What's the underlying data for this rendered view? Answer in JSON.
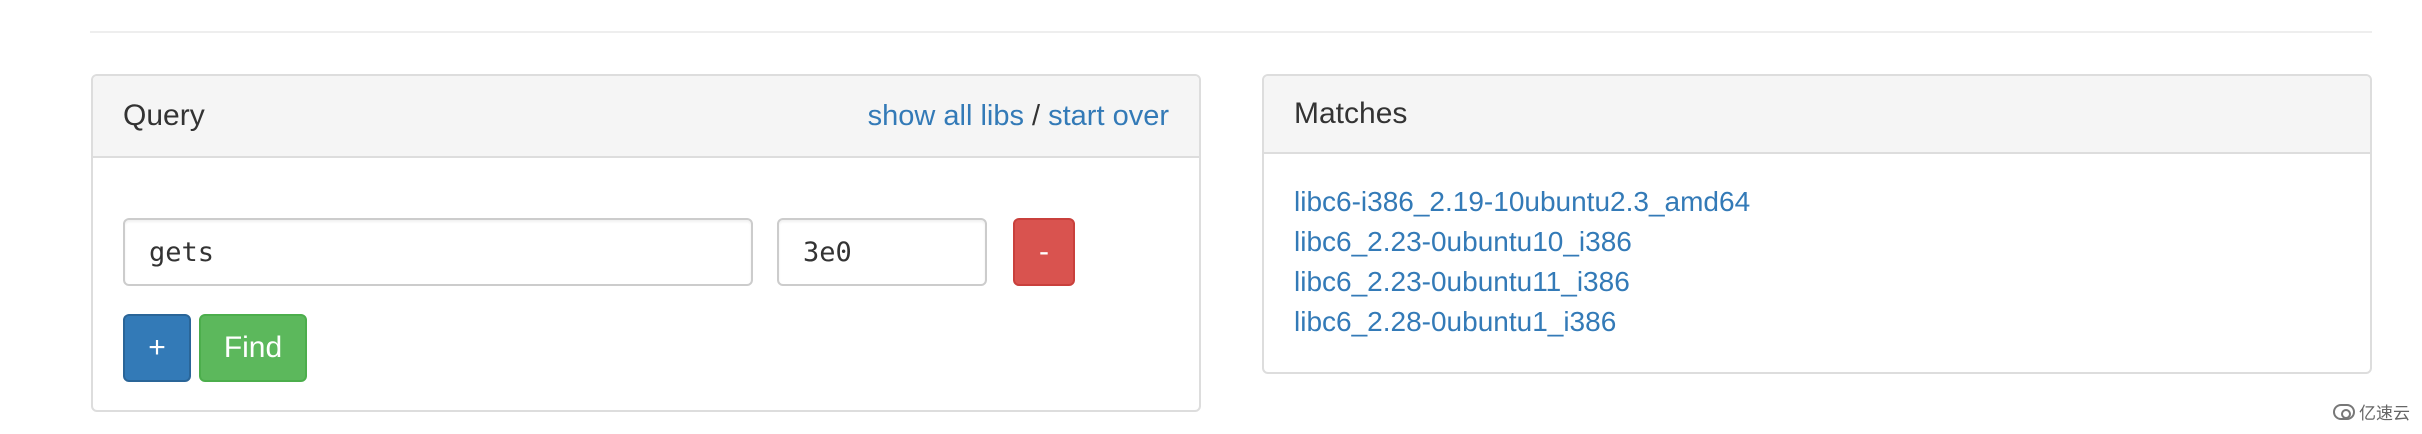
{
  "query": {
    "title": "Query",
    "show_all_label": "show all libs",
    "separator": " / ",
    "start_over_label": "start over",
    "symbol_value": "gets",
    "address_value": "3e0",
    "remove_label": "-",
    "add_label": "+",
    "find_label": "Find"
  },
  "matches": {
    "title": "Matches",
    "items": [
      "libc6-i386_2.19-10ubuntu2.3_amd64",
      "libc6_2.23-0ubuntu10_i386",
      "libc6_2.23-0ubuntu11_i386",
      "libc6_2.28-0ubuntu1_i386"
    ]
  },
  "watermark": {
    "text": "亿速云"
  },
  "colors": {
    "link": "#337ab7",
    "danger": "#d9534f",
    "primary": "#337ab7",
    "success": "#5cb85c"
  }
}
